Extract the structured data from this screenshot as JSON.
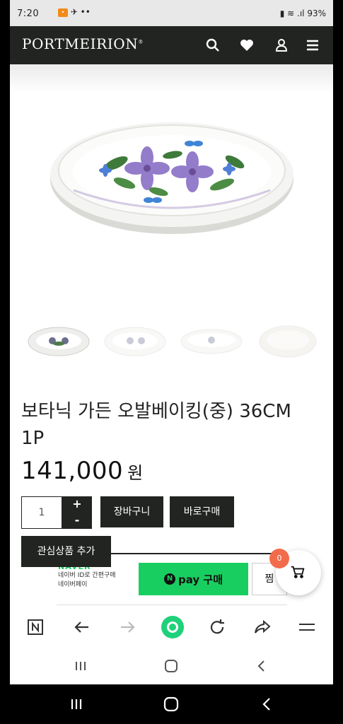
{
  "status": {
    "time": "7:20",
    "right_text": "93%"
  },
  "header": {
    "logo": "PORTMEIRION",
    "logo_tm": "®"
  },
  "product": {
    "title": "보타닉 가든 오발베이킹(중) 36CM 1P",
    "price": "141,000",
    "price_unit": "원"
  },
  "order": {
    "quantity": "1",
    "plus": "+",
    "minus": "-",
    "cart_button": "장바구니",
    "buy_button": "바로구매",
    "wish_button": "관심상품 추가"
  },
  "naver": {
    "brand": "NAVER",
    "line1": "네이버 ID로 간편구매",
    "line2": "네이버페이",
    "pay_n": "N",
    "pay_label": "pay 구매",
    "jjim": "찜"
  },
  "cart": {
    "count": "0"
  },
  "colors": {
    "header_bg": "#222421",
    "naver_green": "#19ce60",
    "badge": "#f26b4b"
  },
  "icons": {
    "header": [
      "search-icon",
      "heart-icon",
      "user-icon",
      "menu-icon"
    ],
    "browser": [
      "naver-n-icon",
      "back-icon",
      "forward-icon",
      "home-circle-icon",
      "refresh-icon",
      "share-icon",
      "menu-icon"
    ]
  }
}
